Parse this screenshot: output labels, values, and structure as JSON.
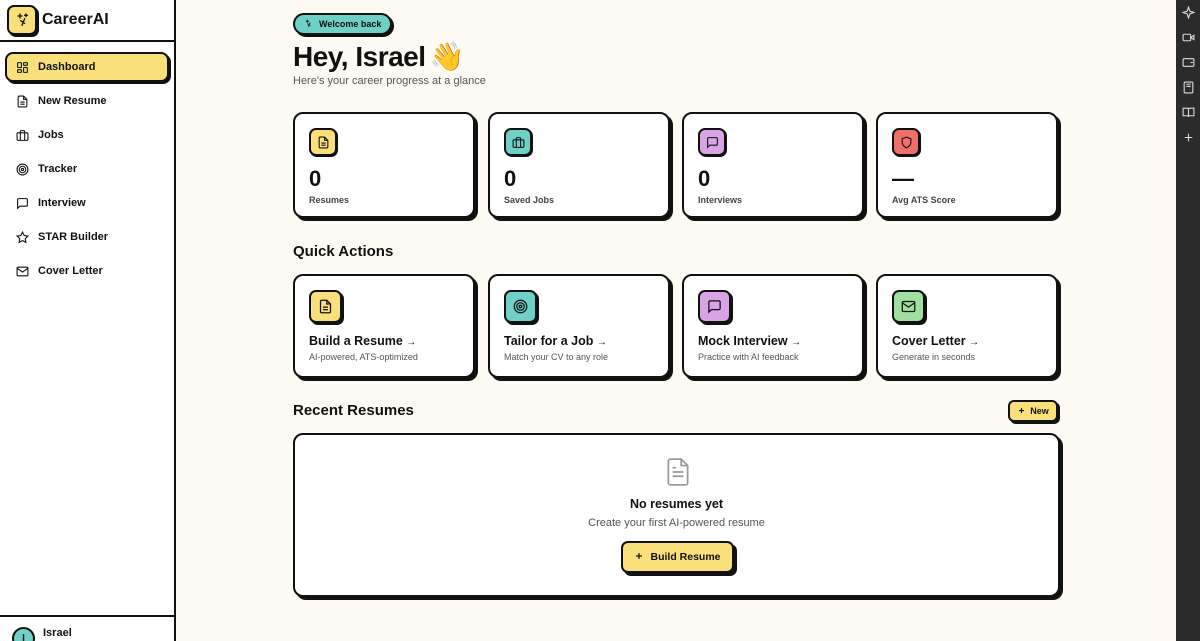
{
  "brand": {
    "name": "CareerAI"
  },
  "sidebar": {
    "items": [
      {
        "label": "Dashboard",
        "icon": "dashboard-icon",
        "active": true
      },
      {
        "label": "New Resume",
        "icon": "document-icon"
      },
      {
        "label": "Jobs",
        "icon": "briefcase-icon"
      },
      {
        "label": "Tracker",
        "icon": "target-icon"
      },
      {
        "label": "Interview",
        "icon": "chat-icon"
      },
      {
        "label": "STAR Builder",
        "icon": "star-icon"
      },
      {
        "label": "Cover Letter",
        "icon": "mail-icon"
      }
    ],
    "user": {
      "name": "Israel",
      "initial": "I"
    }
  },
  "header": {
    "badge": "Welcome back",
    "greeting": "Hey, Israel",
    "emoji": "👋",
    "subtitle": "Here's your career progress at a glance"
  },
  "stats": [
    {
      "value": "0",
      "label": "Resumes",
      "icon": "document-icon",
      "color": "#f9e07a"
    },
    {
      "value": "0",
      "label": "Saved Jobs",
      "icon": "briefcase-icon",
      "color": "#6fd0c8"
    },
    {
      "value": "0",
      "label": "Interviews",
      "icon": "chat-icon",
      "color": "#d9a4e6"
    },
    {
      "value": "—",
      "label": "Avg ATS Score",
      "icon": "shield-icon",
      "color": "#ef6f6a"
    }
  ],
  "quick_actions": {
    "title": "Quick Actions",
    "items": [
      {
        "title": "Build a Resume",
        "arrow": "→",
        "desc": "AI-powered, ATS-optimized",
        "icon": "document-icon",
        "color": "#f9e07a"
      },
      {
        "title": "Tailor for a Job",
        "arrow": "→",
        "desc": "Match your CV to any role",
        "icon": "target-icon",
        "color": "#6fd0c8"
      },
      {
        "title": "Mock Interview",
        "arrow": "→",
        "desc": "Practice with AI feedback",
        "icon": "chat-icon",
        "color": "#d9a4e6"
      },
      {
        "title": "Cover Letter",
        "arrow": "→",
        "desc": "Generate in seconds",
        "icon": "mail-icon",
        "color": "#9fe0a0"
      }
    ]
  },
  "recent": {
    "title": "Recent Resumes",
    "new_label": "New",
    "empty_title": "No resumes yet",
    "empty_desc": "Create your first AI-powered resume",
    "build_label": "Build Resume"
  },
  "colors": {
    "accent_yellow": "#f9e07a",
    "accent_teal": "#6fd0c8",
    "accent_purple": "#d9a4e6",
    "accent_red": "#ef6f6a",
    "accent_green": "#9fe0a0",
    "background": "#fdfbf3"
  }
}
